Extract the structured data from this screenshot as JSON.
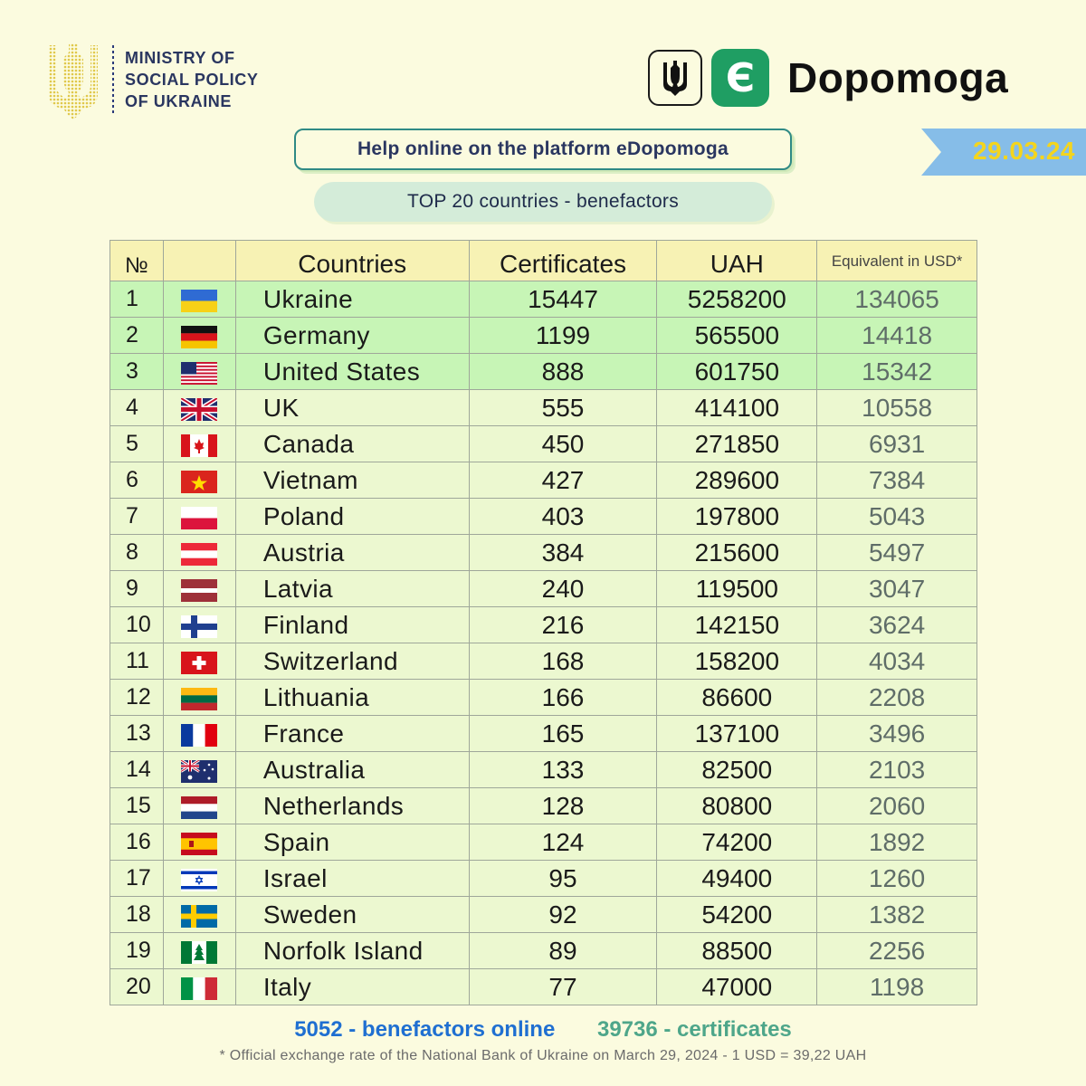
{
  "ministry": {
    "line1": "MINISTRY OF",
    "line2": "SOCIAL POLICY",
    "line3": "OF UKRAINE"
  },
  "brand": {
    "letter": "Є",
    "name": "Dopomoga"
  },
  "date": "29.03.24",
  "subtitle": "Help online on the platform eDopomoga",
  "table_title": "TOP 20 countries - benefactors",
  "headers": {
    "num": "№",
    "countries": "Countries",
    "certificates": "Certificates",
    "uah": "UAH",
    "usd": "Equivalent in USD*"
  },
  "rows": [
    {
      "n": "1",
      "country": "Ukraine",
      "cert": "15447",
      "uah": "5258200",
      "usd": "134065",
      "flag": "ukraine-flag-icon"
    },
    {
      "n": "2",
      "country": "Germany",
      "cert": "1199",
      "uah": "565500",
      "usd": "14418",
      "flag": "germany-flag-icon"
    },
    {
      "n": "3",
      "country": "United States",
      "cert": "888",
      "uah": "601750",
      "usd": "15342",
      "flag": "usa-flag-icon"
    },
    {
      "n": "4",
      "country": "UK",
      "cert": "555",
      "uah": "414100",
      "usd": "10558",
      "flag": "uk-flag-icon"
    },
    {
      "n": "5",
      "country": "Canada",
      "cert": "450",
      "uah": "271850",
      "usd": "6931",
      "flag": "canada-flag-icon"
    },
    {
      "n": "6",
      "country": "Vietnam",
      "cert": "427",
      "uah": "289600",
      "usd": "7384",
      "flag": "vietnam-flag-icon"
    },
    {
      "n": "7",
      "country": "Poland",
      "cert": "403",
      "uah": "197800",
      "usd": "5043",
      "flag": "poland-flag-icon"
    },
    {
      "n": "8",
      "country": "Austria",
      "cert": "384",
      "uah": "215600",
      "usd": "5497",
      "flag": "austria-flag-icon"
    },
    {
      "n": "9",
      "country": "Latvia",
      "cert": "240",
      "uah": "119500",
      "usd": "3047",
      "flag": "latvia-flag-icon"
    },
    {
      "n": "10",
      "country": "Finland",
      "cert": "216",
      "uah": "142150",
      "usd": "3624",
      "flag": "finland-flag-icon"
    },
    {
      "n": "11",
      "country": "Switzerland",
      "cert": "168",
      "uah": "158200",
      "usd": "4034",
      "flag": "switzerland-flag-icon"
    },
    {
      "n": "12",
      "country": "Lithuania",
      "cert": "166",
      "uah": "86600",
      "usd": "2208",
      "flag": "lithuania-flag-icon"
    },
    {
      "n": "13",
      "country": "France",
      "cert": "165",
      "uah": "137100",
      "usd": "3496",
      "flag": "france-flag-icon"
    },
    {
      "n": "14",
      "country": "Australia",
      "cert": "133",
      "uah": "82500",
      "usd": "2103",
      "flag": "australia-flag-icon"
    },
    {
      "n": "15",
      "country": "Netherlands",
      "cert": "128",
      "uah": "80800",
      "usd": "2060",
      "flag": "netherlands-flag-icon"
    },
    {
      "n": "16",
      "country": "Spain",
      "cert": "124",
      "uah": "74200",
      "usd": "1892",
      "flag": "spain-flag-icon"
    },
    {
      "n": "17",
      "country": "Israel",
      "cert": "95",
      "uah": "49400",
      "usd": "1260",
      "flag": "israel-flag-icon"
    },
    {
      "n": "18",
      "country": "Sweden",
      "cert": "92",
      "uah": "54200",
      "usd": "1382",
      "flag": "sweden-flag-icon"
    },
    {
      "n": "19",
      "country": "Norfolk Island",
      "cert": "89",
      "uah": "88500",
      "usd": "2256",
      "flag": "norfolk-island-flag-icon"
    },
    {
      "n": "20",
      "country": "Italy",
      "cert": "77",
      "uah": "47000",
      "usd": "1198",
      "flag": "italy-flag-icon"
    }
  ],
  "footer": {
    "benefactors": "5052 - benefactors online",
    "certificates": "39736 - certificates"
  },
  "note": "* Official exchange rate of the National Bank of Ukraine on March 29, 2024 - 1 USD = 39,22 UAH",
  "colors": {
    "background": "#fbfbdf",
    "top3_row": "#c7f5b6",
    "row": "#ecf8d0",
    "header": "#f7f2b4",
    "brand_green": "#1f9e63",
    "date_ribbon": "#86bde8",
    "date_text": "#f4d51d",
    "benefactors_text": "#1f6fd1",
    "certificates_text": "#4ea68a"
  }
}
